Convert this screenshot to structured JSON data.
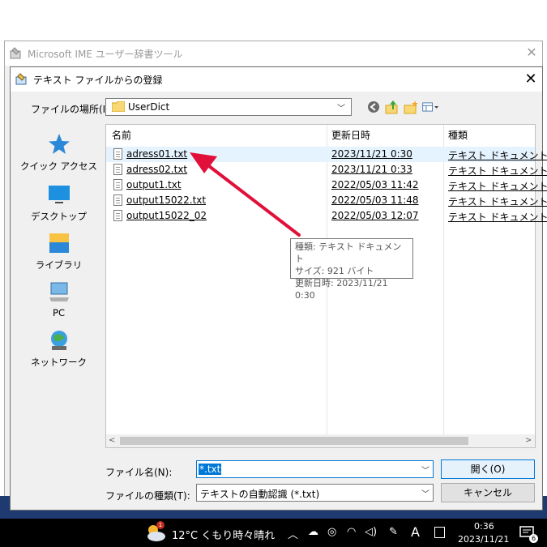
{
  "background_window": {
    "title": "Microsoft IME ユーザー辞書ツール"
  },
  "dialog": {
    "title": "テキスト ファイルからの登録",
    "look_in_label": "ファイルの場所(I):",
    "look_in_value": "UserDict",
    "places": [
      {
        "label": "クイック アクセス",
        "icon": "star-icon"
      },
      {
        "label": "デスクトップ",
        "icon": "desktop-icon"
      },
      {
        "label": "ライブラリ",
        "icon": "library-icon"
      },
      {
        "label": "PC",
        "icon": "pc-icon"
      },
      {
        "label": "ネットワーク",
        "icon": "network-icon"
      }
    ],
    "columns": {
      "name": "名前",
      "modified": "更新日時",
      "type": "種類"
    },
    "files": [
      {
        "name": "adress01.txt",
        "modified": "2023/11/21 0:30",
        "type": "テキスト ドキュメント"
      },
      {
        "name": "adress02.txt",
        "modified": "2023/11/21 0:33",
        "type": "テキスト ドキュメント"
      },
      {
        "name": "output1.txt",
        "modified": "2022/05/03 11:42",
        "type": "テキスト ドキュメント"
      },
      {
        "name": "output15022.txt",
        "modified": "2022/05/03 11:48",
        "type": "テキスト ドキュメント"
      },
      {
        "name": "output15022_02",
        "modified": "2022/05/03 12:07",
        "type": "テキスト ドキュメント"
      }
    ],
    "tooltip": {
      "line1": "種類: テキスト ドキュメント",
      "line2": "サイズ: 921 バイト",
      "line3": "更新日時: 2023/11/21 0:30"
    },
    "filename_label": "ファイル名(N):",
    "filename_value": "*.txt",
    "filetype_label": "ファイルの種類(T):",
    "filetype_value": "テキストの自動認識 (*.txt)",
    "open_label": "開く(O)",
    "cancel_label": "キャンセル"
  },
  "taskbar": {
    "weather_badge": "1",
    "weather": "12°C くもり時々晴れ",
    "ime_mode": "A",
    "time": "0:36",
    "date": "2023/11/21",
    "notification_count": "6"
  },
  "colors": {
    "accent": "#0078d7",
    "arrow": "#e0103a",
    "selection": "#e5f3ff"
  }
}
